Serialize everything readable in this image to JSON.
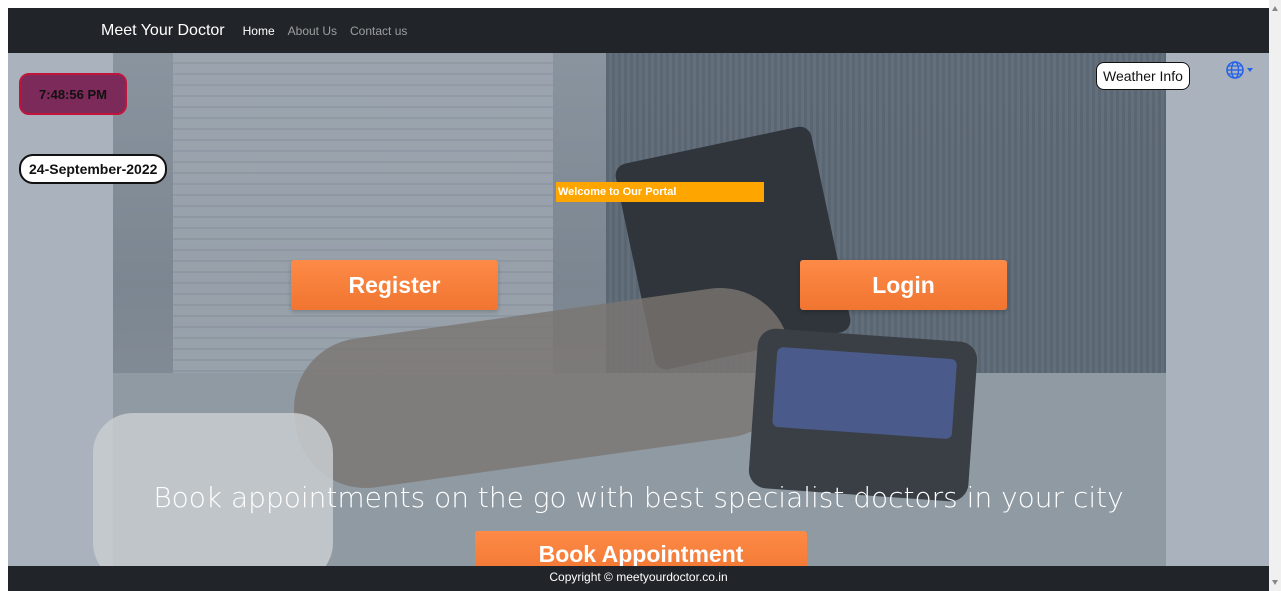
{
  "navbar": {
    "brand": "Meet Your Doctor",
    "links": [
      {
        "label": "Home",
        "active": true
      },
      {
        "label": "About Us",
        "active": false
      },
      {
        "label": "Contact us",
        "active": false
      }
    ]
  },
  "hero": {
    "time": "7:48:56 PM",
    "date": "24-September-2022",
    "weather_button": "Weather Info",
    "language_icon": "globe-icon",
    "welcome": "Welcome to Our Portal",
    "register_button": "Register",
    "login_button": "Login",
    "tagline": "Book appointments on the go with best specialist doctors in your city",
    "book_button": "Book Appointment"
  },
  "footer": {
    "text": "Copyright © meetyourdoctor.co.in"
  },
  "colors": {
    "navbar_bg": "#212529",
    "accent_orange": "#f58233",
    "welcome_bg": "#ffa500",
    "time_badge_bg": "#7b2a5a",
    "time_badge_border": "#c0143c",
    "globe": "#2563eb"
  }
}
